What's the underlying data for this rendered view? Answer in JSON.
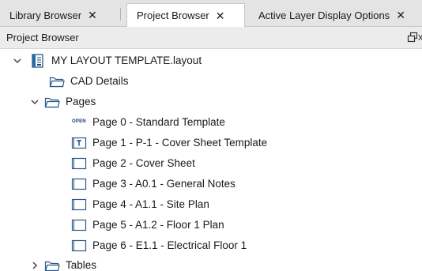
{
  "tabs": [
    {
      "label": "Library Browser",
      "close": "✕"
    },
    {
      "label": "Project Browser",
      "close": "✕"
    },
    {
      "label": "Active Layer Display Options",
      "close": "✕"
    }
  ],
  "panel": {
    "title": "Project Browser",
    "close_glyph": "x"
  },
  "tree": {
    "root": {
      "label": "MY LAYOUT TEMPLATE.layout",
      "expanded": true,
      "icon": "layout-file-icon"
    },
    "cad_details": {
      "label": "CAD Details",
      "icon": "folder-icon"
    },
    "pages": {
      "label": "Pages",
      "expanded": true,
      "icon": "folder-icon"
    },
    "page_items": [
      {
        "label": "Page 0 - Standard Template",
        "icon": "open-badge-icon",
        "badge": "OPEN"
      },
      {
        "label": "Page 1 - P-1 - Cover Sheet Template",
        "icon": "template-page-icon"
      },
      {
        "label": "Page 2 - Cover Sheet",
        "icon": "page-icon"
      },
      {
        "label": "Page 3 - A0.1 - General Notes",
        "icon": "page-icon"
      },
      {
        "label": "Page 4 - A1.1 - Site Plan",
        "icon": "page-icon"
      },
      {
        "label": "Page 5 - A1.2 - Floor 1 Plan",
        "icon": "page-icon"
      },
      {
        "label": "Page 6 - E1.1 - Electrical Floor 1",
        "icon": "page-icon"
      }
    ],
    "tables": {
      "label": "Tables",
      "expanded": false,
      "icon": "folder-icon"
    }
  }
}
